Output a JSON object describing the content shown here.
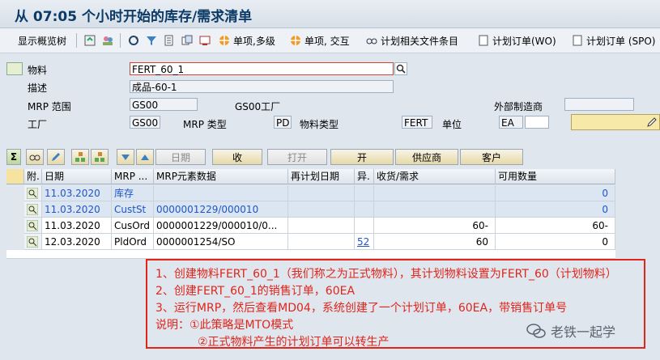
{
  "window": {
    "title": "从 07:05 个小时开始的库存/需求清单"
  },
  "toolbar": {
    "show_overview_tree": "显示概览树",
    "single_item_multilevel": "单项,多级",
    "single_item_interactive": "单项, 交互",
    "plan_related_entries": "计划相关文件条目",
    "planned_order_wo": "计划订单(WO)",
    "planned_order_spo": "计划订单 (SPO)"
  },
  "header": {
    "material_label": "物料",
    "material_value": "FERT_60_1",
    "description_label": "描述",
    "description_value": "成品-60-1",
    "mrp_area_label": "MRP 范围",
    "mrp_area_value": "GS00",
    "mrp_area_text": "GS00工厂",
    "external_vendor_label": "外部制造商",
    "plant_label": "工厂",
    "plant_value": "GS00",
    "mrp_type_label": "MRP 类型",
    "mrp_type_value": "PD",
    "material_type_label": "物料类型",
    "material_type_value": "FERT",
    "unit_label": "单位",
    "unit_value": "EA"
  },
  "buttons": {
    "date": "日期",
    "receipt": "收",
    "open": "打开",
    "open2": "开",
    "vendor": "供应商",
    "customer": "客户"
  },
  "table": {
    "columns": [
      "附.",
      "日期",
      "MRP ...",
      "MRP元素数据",
      "再计划日期",
      "异.",
      "收货/需求",
      "可用数量"
    ],
    "rows": [
      {
        "date": "11.03.2020",
        "mrp": "库存",
        "data": "",
        "resched": "",
        "exc": "",
        "qty": "",
        "avail": "0",
        "blue": true
      },
      {
        "date": "11.03.2020",
        "mrp": "CustSt",
        "data": "0000001229/000010",
        "resched": "",
        "exc": "",
        "qty": "",
        "avail": "0",
        "blue": true
      },
      {
        "date": "11.03.2020",
        "mrp": "CusOrd",
        "data": "0000001229/000010/0...",
        "resched": "",
        "exc": "",
        "qty": "60-",
        "avail": "60-",
        "blue": false
      },
      {
        "date": "12.03.2020",
        "mrp": "PldOrd",
        "data": "0000001254/SO",
        "resched": "",
        "exc": "52",
        "qty": "60",
        "avail": "0",
        "blue": false
      }
    ]
  },
  "note": {
    "line1": "1、创建物料FERT_60_1（我们称之为正式物料），其计划物料设置为FERT_60（计划物料）",
    "line2": "2、创建FERT_60_1的销售订单，60EA",
    "line3": "3、运行MRP，然后查看MD04，系统创建了一个计划订单，60EA，带销售订单号",
    "line4": "说明：①此策略是MTO模式",
    "line5": "②正式物料产生的计划订单可以转生产"
  },
  "watermark": {
    "text": "老铁一起学"
  },
  "colors": {
    "note_red": "#e0251b",
    "link_blue": "#1e56c8"
  }
}
